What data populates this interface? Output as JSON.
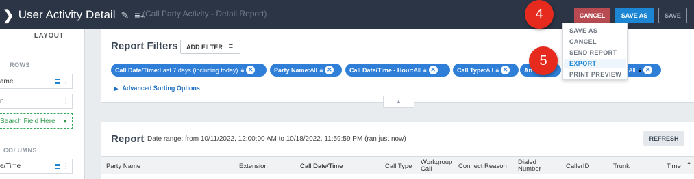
{
  "header": {
    "title": "User Activity Detail",
    "subtitle": "(Call Party Activity - Detail Report)",
    "cancel_label": "CANCEL",
    "save_as_label": "SAVE AS",
    "save_label": "SAVE"
  },
  "annotations": {
    "step4": "4",
    "step5": "5"
  },
  "dropdown": {
    "items": [
      "SAVE AS",
      "CANCEL",
      "SEND REPORT",
      "EXPORT",
      "PRINT PREVIEW"
    ],
    "highlighted": "EXPORT"
  },
  "layout_panel": {
    "header": "LAYOUT",
    "rows_label": "ROWS",
    "row_fields": [
      "ame",
      "n"
    ],
    "search_placeholder": "Search Field Here",
    "columns_label": "COLUMNS",
    "column_fields": [
      "e/Time"
    ]
  },
  "filters": {
    "title": "Report Filters",
    "add_filter_label": "ADD FILTER",
    "chips": [
      {
        "name": "Call Date/Time:",
        "value": " Last 7 days (including today)"
      },
      {
        "name": "Party Name:",
        "value": " All"
      },
      {
        "name": "Call Date/Time - Hour:",
        "value": " All"
      },
      {
        "name": "Call Type:",
        "value": " All"
      },
      {
        "name": "An",
        "value": ""
      },
      {
        "name": "",
        "value": ": All"
      }
    ],
    "advanced_sorting_label": "Advanced Sorting Options"
  },
  "report": {
    "title": "Report",
    "date_range": "Date range: from 10/11/2022, 12:00:00 AM to 10/18/2022, 11:59:59 PM (ran just now)",
    "refresh_label": "REFRESH",
    "columns": [
      "Party Name",
      "Extension",
      "Call Date/Time",
      "Call Type",
      "Workgroup Call",
      "Connect Reason",
      "Dialed Number",
      "CallerID",
      "Trunk",
      "Time"
    ],
    "sorted_column": "Call Date/Time"
  },
  "colors": {
    "topbar": "#2b3545",
    "cancel": "#b84b52",
    "save_as": "#1c86d4",
    "chip": "#2f7fd8",
    "badge": "#e62b1e"
  }
}
